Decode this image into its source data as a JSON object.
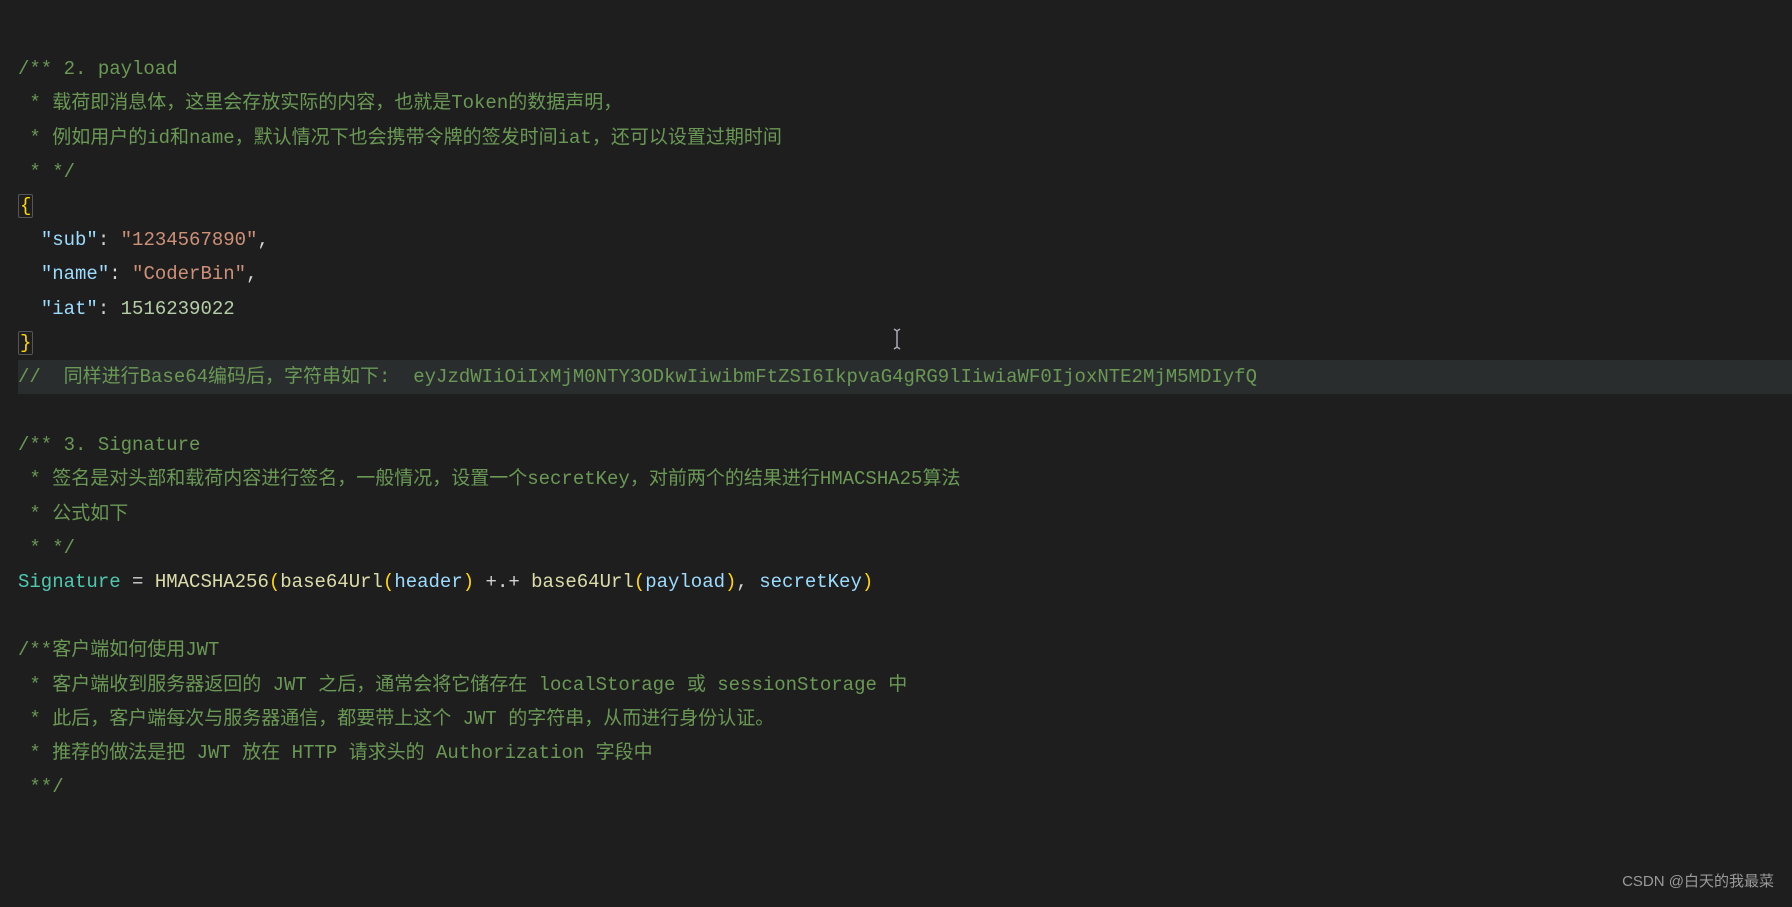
{
  "lines": {
    "l1a": "/** 2. payload",
    "l2": " * 载荷即消息体，这里会存放实际的内容，也就是Token的数据声明，",
    "l3": " * 例如用户的id和name，默认情况下也会携带令牌的签发时间iat，还可以设置过期时间",
    "l4": " * */",
    "l5": "{",
    "l6_key": "\"sub\"",
    "l6_val": "\"1234567890\"",
    "l7_key": "\"name\"",
    "l7_val": "\"CoderBin\"",
    "l8_key": "\"iat\"",
    "l8_val": "1516239022",
    "l9": "}",
    "l10_a": "//  同样进行Base64编码后，字符串如下:  ",
    "l10_b": "eyJzdWIiOiIxMjM0NTY3ODkwIiwibmFtZSI6IkpvaG4gRG9lIiwiaWF0IjoxNTE2MjM5MDIyfQ",
    "l11": "/** 3. Signature",
    "l12": " * 签名是对头部和载荷内容进行签名，一般情况，设置一个secretKey，对前两个的结果进行HMACSHA25算法",
    "l13": " * 公式如下",
    "l14": " * */",
    "sig_var": "Signature",
    "sig_eq": " = ",
    "sig_fn1": "HMACSHA256",
    "sig_fn2": "base64Url",
    "sig_h": "header",
    "sig_p": "payload",
    "sig_plus": " +.+ ",
    "sig_sk": "secretKey",
    "l17": "/**客户端如何使用JWT",
    "l18": " * 客户端收到服务器返回的 JWT 之后，通常会将它储存在 localStorage 或 sessionStorage 中",
    "l19": " * 此后，客户端每次与服务器通信，都要带上这个 JWT 的字符串，从而进行身份认证。",
    "l20": " * 推荐的做法是把 JWT 放在 HTTP 请求头的 Authorization 字段中",
    "l21": " **/"
  },
  "watermark": "CSDN @白天的我最菜"
}
